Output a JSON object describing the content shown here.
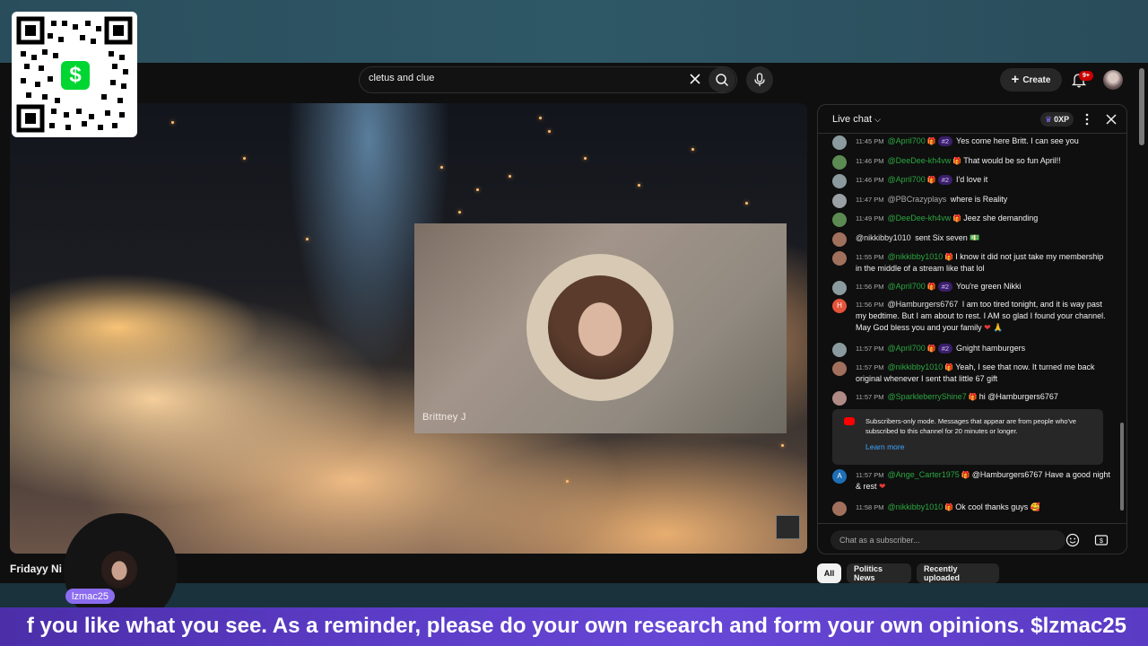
{
  "search": {
    "query": "cletus and clue"
  },
  "header": {
    "create_label": "Create",
    "notifications_badge": "9+"
  },
  "video": {
    "overlay_name": "Brittney J",
    "title": "Fridayy Ni"
  },
  "qr": {
    "cash_symbol": "$"
  },
  "chat": {
    "title": "Live chat",
    "xp": "0XP",
    "messages": [
      {
        "time": "11:45 PM",
        "author": "@April700",
        "rank": "#2",
        "text": "Yes come here Britt. I can see you"
      },
      {
        "time": "11:46 PM",
        "author": "@DeeDee-kh4vw",
        "text": "That would be so fun April!!"
      },
      {
        "time": "11:46 PM",
        "author": "@April700",
        "rank": "#2",
        "text": "I'd love it"
      },
      {
        "time": "11:47 PM",
        "author": "@PBCrazyplays",
        "text": "where is Reality"
      },
      {
        "time": "11:49 PM",
        "author": "@DeeDee-kh4vw",
        "text": "Jeez she demanding"
      },
      {
        "time": "",
        "author": "@nikkibby1010",
        "text": "sent Six seven"
      },
      {
        "time": "11:55 PM",
        "author": "@nikkibby1010",
        "text": "I know it did not just take my membership in the middle of a stream like that lol"
      },
      {
        "time": "11:56 PM",
        "author": "@April700",
        "rank": "#2",
        "text": "You're green Nikki"
      },
      {
        "time": "11:56 PM",
        "author": "@Hamburgers6767",
        "text": "I am too tired tonight, and it is way past my bedtime. But I am about to rest. I AM so glad I found your channel. May God bless you and your family"
      },
      {
        "time": "11:57 PM",
        "author": "@April700",
        "rank": "#2",
        "text": "Gnight hamburgers"
      },
      {
        "time": "11:57 PM",
        "author": "@nikkibby1010",
        "text": "Yeah, I see that now. It turned me back original whenever I sent that little 67 gift"
      },
      {
        "time": "11:57 PM",
        "author": "@SparkleberryShine7",
        "text": "hi @Hamburgers6767"
      },
      {
        "time": "11:57 PM",
        "author": "@Ange_Carter1975",
        "text": "@Hamburgers6767 Have a good night & rest"
      },
      {
        "time": "11:58 PM",
        "author": "@nikkibby1010",
        "text": "Ok cool thanks guys"
      }
    ],
    "notice": {
      "text": "Subscribers-only mode. Messages that appear are from people who've subscribed to this channel for 20 minutes or longer.",
      "link": "Learn more"
    },
    "input_placeholder": "Chat as a subscriber...",
    "hamburgers_avatar_letter": "H",
    "ange_avatar_letter": "A"
  },
  "chips": [
    "All",
    "Politics News",
    "Recently uploaded"
  ],
  "streamer": {
    "name": "lzmac25"
  },
  "ticker": {
    "text": "f you like what you see. As a reminder, please do your own research and form your own opinions. $lzmac25"
  },
  "colors": {
    "author_green": "#2ba640",
    "ticker_purple": "#5a3bc4",
    "cash_green": "#00d632",
    "link_blue": "#3ea6ff"
  }
}
